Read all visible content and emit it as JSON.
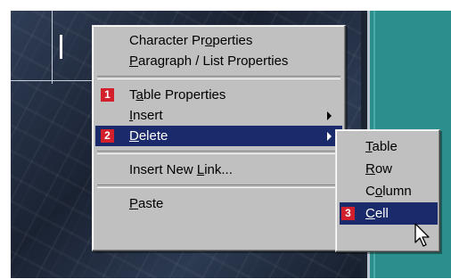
{
  "context_menu": {
    "items": [
      {
        "pre": "Character Pr",
        "key": "o",
        "post": "perties"
      },
      {
        "pre": "",
        "key": "P",
        "post": "aragraph / List Properties"
      },
      {
        "badge": "1",
        "pre": "T",
        "key": "a",
        "post": "ble Properties"
      },
      {
        "pre": "",
        "key": "I",
        "post": "nsert"
      },
      {
        "badge": "2",
        "pre": "",
        "key": "D",
        "post": "elete"
      },
      {
        "pre": "Insert New ",
        "key": "L",
        "post": "ink..."
      },
      {
        "pre": "",
        "key": "P",
        "post": "aste"
      }
    ]
  },
  "submenu": {
    "items": [
      {
        "pre": "",
        "key": "T",
        "post": "able"
      },
      {
        "pre": "",
        "key": "R",
        "post": "ow"
      },
      {
        "pre": "C",
        "key": "o",
        "post": "lumn"
      },
      {
        "badge": "3",
        "pre": "",
        "key": "C",
        "post": "ell"
      }
    ]
  },
  "colors": {
    "menu_bg": "#c0c0c0",
    "highlight": "#1b2a6b",
    "badge": "#d21f2b",
    "teal_panel": "#2a8f8d"
  },
  "icons": [
    "submenu-arrow-icon",
    "mouse-pointer-icon"
  ]
}
